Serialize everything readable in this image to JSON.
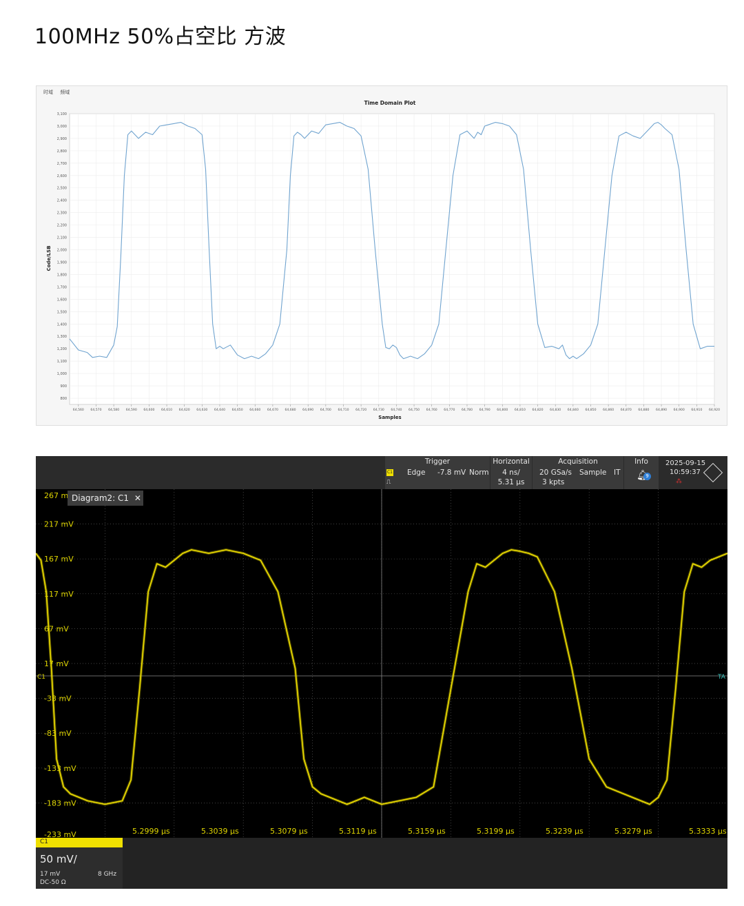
{
  "page_title": "100MHz 50%占空比 方波",
  "chart_data": [
    {
      "type": "line",
      "tabs": [
        "时域",
        "频域"
      ],
      "title": "Time Domain Plot",
      "xlabel": "Samples",
      "ylabel": "Code/LSB",
      "xlim": [
        64555,
        64920
      ],
      "ylim": [
        750,
        3100
      ],
      "x_ticks": [
        64560,
        64570,
        64580,
        64590,
        64600,
        64610,
        64620,
        64630,
        64640,
        64650,
        64660,
        64670,
        64680,
        64690,
        64700,
        64710,
        64720,
        64730,
        64740,
        64750,
        64760,
        64770,
        64780,
        64790,
        64800,
        64810,
        64820,
        64830,
        64840,
        64850,
        64860,
        64870,
        64880,
        64890,
        64900,
        64910,
        64920
      ],
      "x_tick_labels": [
        "64,560",
        "64,570",
        "64,580",
        "64,590",
        "64,600",
        "64,610",
        "64,620",
        "64,630",
        "64,640",
        "64,650",
        "64,660",
        "64,670",
        "64,680",
        "64,690",
        "64,700",
        "64,710",
        "64,720",
        "64,730",
        "64,740",
        "64,750",
        "64,760",
        "64,770",
        "64,780",
        "64,790",
        "64,800",
        "64,810",
        "64,820",
        "64,830",
        "64,840",
        "64,850",
        "64,860",
        "64,870",
        "64,880",
        "64,890",
        "64,900",
        "64,910",
        "64,920"
      ],
      "y_ticks": [
        800,
        900,
        1000,
        1100,
        1200,
        1300,
        1400,
        1500,
        1600,
        1700,
        1800,
        1900,
        2000,
        2100,
        2200,
        2300,
        2400,
        2500,
        2600,
        2700,
        2800,
        2900,
        3000,
        3100
      ],
      "y_tick_labels": [
        "800",
        "900",
        "1,000",
        "1,100",
        "1,200",
        "1,300",
        "1,400",
        "1,500",
        "1,600",
        "1,700",
        "1,800",
        "1,900",
        "2,000",
        "2,100",
        "2,200",
        "2,300",
        "2,400",
        "2,500",
        "2,600",
        "2,700",
        "2,800",
        "2,900",
        "3,000",
        "3,100"
      ],
      "grid": true,
      "series": [
        {
          "color": "#6fa3cf",
          "x": [
            64555,
            64560,
            64565,
            64568,
            64572,
            64576,
            64580,
            64582,
            64584,
            64586,
            64588,
            64590,
            64592,
            64594,
            64598,
            64602,
            64606,
            64610,
            64614,
            64618,
            64622,
            64626,
            64630,
            64632,
            64634,
            64636,
            64638,
            64640,
            64642,
            64646,
            64650,
            64654,
            64658,
            64662,
            64666,
            64670,
            64674,
            64678,
            64680,
            64682,
            64684,
            64686,
            64688,
            64692,
            64696,
            64700,
            64704,
            64708,
            64712,
            64716,
            64720,
            64724,
            64728,
            64732,
            64734,
            64736,
            64738,
            64740,
            64742,
            64744,
            64748,
            64752,
            64756,
            64760,
            64764,
            64768,
            64772,
            64776,
            64780,
            64782,
            64784,
            64786,
            64788,
            64790,
            64792,
            64796,
            64800,
            64804,
            64808,
            64812,
            64816,
            64820,
            64824,
            64828,
            64832,
            64834,
            64836,
            64838,
            64840,
            64842,
            64846,
            64850,
            64854,
            64858,
            64862,
            64866,
            64870,
            64874,
            64878,
            64882,
            64884,
            64886,
            64888,
            64890,
            64892,
            64896,
            64900,
            64904,
            64908,
            64912,
            64916,
            64920
          ],
          "y": [
            1280,
            1190,
            1170,
            1130,
            1140,
            1130,
            1230,
            1380,
            1950,
            2600,
            2930,
            2960,
            2930,
            2900,
            2950,
            2930,
            3000,
            3010,
            3020,
            3030,
            3000,
            2980,
            2930,
            2650,
            2000,
            1400,
            1200,
            1220,
            1200,
            1230,
            1150,
            1120,
            1140,
            1120,
            1160,
            1230,
            1400,
            2000,
            2600,
            2920,
            2950,
            2930,
            2900,
            2960,
            2940,
            3010,
            3020,
            3030,
            3000,
            2980,
            2920,
            2650,
            2000,
            1400,
            1210,
            1200,
            1230,
            1210,
            1150,
            1120,
            1140,
            1120,
            1160,
            1230,
            1400,
            2000,
            2600,
            2930,
            2960,
            2930,
            2900,
            2950,
            2930,
            3000,
            3010,
            3030,
            3020,
            3000,
            2930,
            2650,
            2000,
            1400,
            1210,
            1220,
            1200,
            1230,
            1150,
            1120,
            1140,
            1120,
            1160,
            1230,
            1400,
            2000,
            2600,
            2920,
            2950,
            2920,
            2900,
            2960,
            2990,
            3020,
            3030,
            3010,
            2980,
            2930,
            2650,
            2000,
            1400,
            1200,
            1220,
            1220
          ]
        }
      ]
    },
    {
      "type": "line",
      "diagram_tab": "Diagram2: C1",
      "header": {
        "trigger_label": "Trigger",
        "trigger_channel": "C1",
        "trigger_type": "Edge",
        "trigger_level": "-7.8 mV",
        "trigger_mode": "Norm",
        "horizontal_label": "Horizontal",
        "horizontal_scale": "4 ns/",
        "horizontal_position": "5.31 µs",
        "acquisition_label": "Acquisition",
        "acquisition_rate": "20 GSa/s",
        "acquisition_mode": "Sample",
        "acquisition_extra": "IT",
        "acquisition_points": "3 kpts",
        "info_label": "Info",
        "info_count": "9",
        "date": "2025-09-15",
        "time": "10:59:37"
      },
      "y_ticks": [
        267,
        217,
        167,
        117,
        67,
        17,
        -33,
        -83,
        -133,
        -183,
        -233
      ],
      "y_tick_labels": [
        "267 mV",
        "217 mV",
        "167 mV",
        "117 mV",
        "67 mV",
        "17 mV",
        "-33 mV",
        "-83 mV",
        "-133 mV",
        "-183 mV",
        "-233 mV"
      ],
      "x_tick_labels": [
        "5.2999 µs",
        "5.3039 µs",
        "5.3079 µs",
        "5.3119 µs",
        "5.3159 µs",
        "5.3199 µs",
        "5.3239 µs",
        "5.3279 µs",
        "5.3333 µs"
      ],
      "xlim_ns": [
        0,
        40
      ],
      "ylim_mV": [
        -233,
        267
      ],
      "channel_marker": "C1",
      "right_marker": "TA",
      "channel_box": {
        "name": "C1",
        "scale": "50 mV/",
        "offset": "17 mV",
        "bandwidth": "8 GHz",
        "coupling": "DC-50 Ω"
      },
      "series": [
        {
          "color": "#f0e000",
          "x": [
            0,
            0.3,
            0.6,
            0.9,
            1.2,
            1.6,
            2.0,
            3.0,
            4.0,
            5.0,
            5.5,
            6.0,
            6.5,
            7.0,
            7.5,
            8.0,
            8.5,
            9.0,
            10.0,
            11.0,
            12.0,
            13.0,
            14.0,
            15.0,
            15.5,
            16.0,
            16.5,
            17.0,
            17.5,
            18.0,
            18.5,
            19.0,
            20.0,
            21.0,
            22.0,
            23.0,
            24.0,
            25.0,
            25.5,
            26.0,
            26.5,
            27.0,
            27.5,
            28.0,
            28.5,
            29.0,
            30.0,
            31.0,
            32.0,
            33.0,
            34.0,
            35.0,
            35.5,
            36.0,
            36.5,
            37.0,
            37.5,
            38.0,
            38.5,
            39.0,
            40.0
          ],
          "y": [
            175,
            165,
            120,
            10,
            -120,
            -160,
            -170,
            -180,
            -185,
            -180,
            -150,
            -20,
            120,
            160,
            155,
            165,
            175,
            180,
            175,
            180,
            175,
            165,
            120,
            10,
            -120,
            -160,
            -170,
            -175,
            -180,
            -185,
            -180,
            -175,
            -185,
            -180,
            -175,
            -160,
            -20,
            120,
            160,
            155,
            165,
            175,
            180,
            178,
            175,
            170,
            120,
            10,
            -120,
            -160,
            -170,
            -180,
            -185,
            -175,
            -150,
            -20,
            120,
            160,
            155,
            165,
            175
          ]
        }
      ]
    }
  ]
}
